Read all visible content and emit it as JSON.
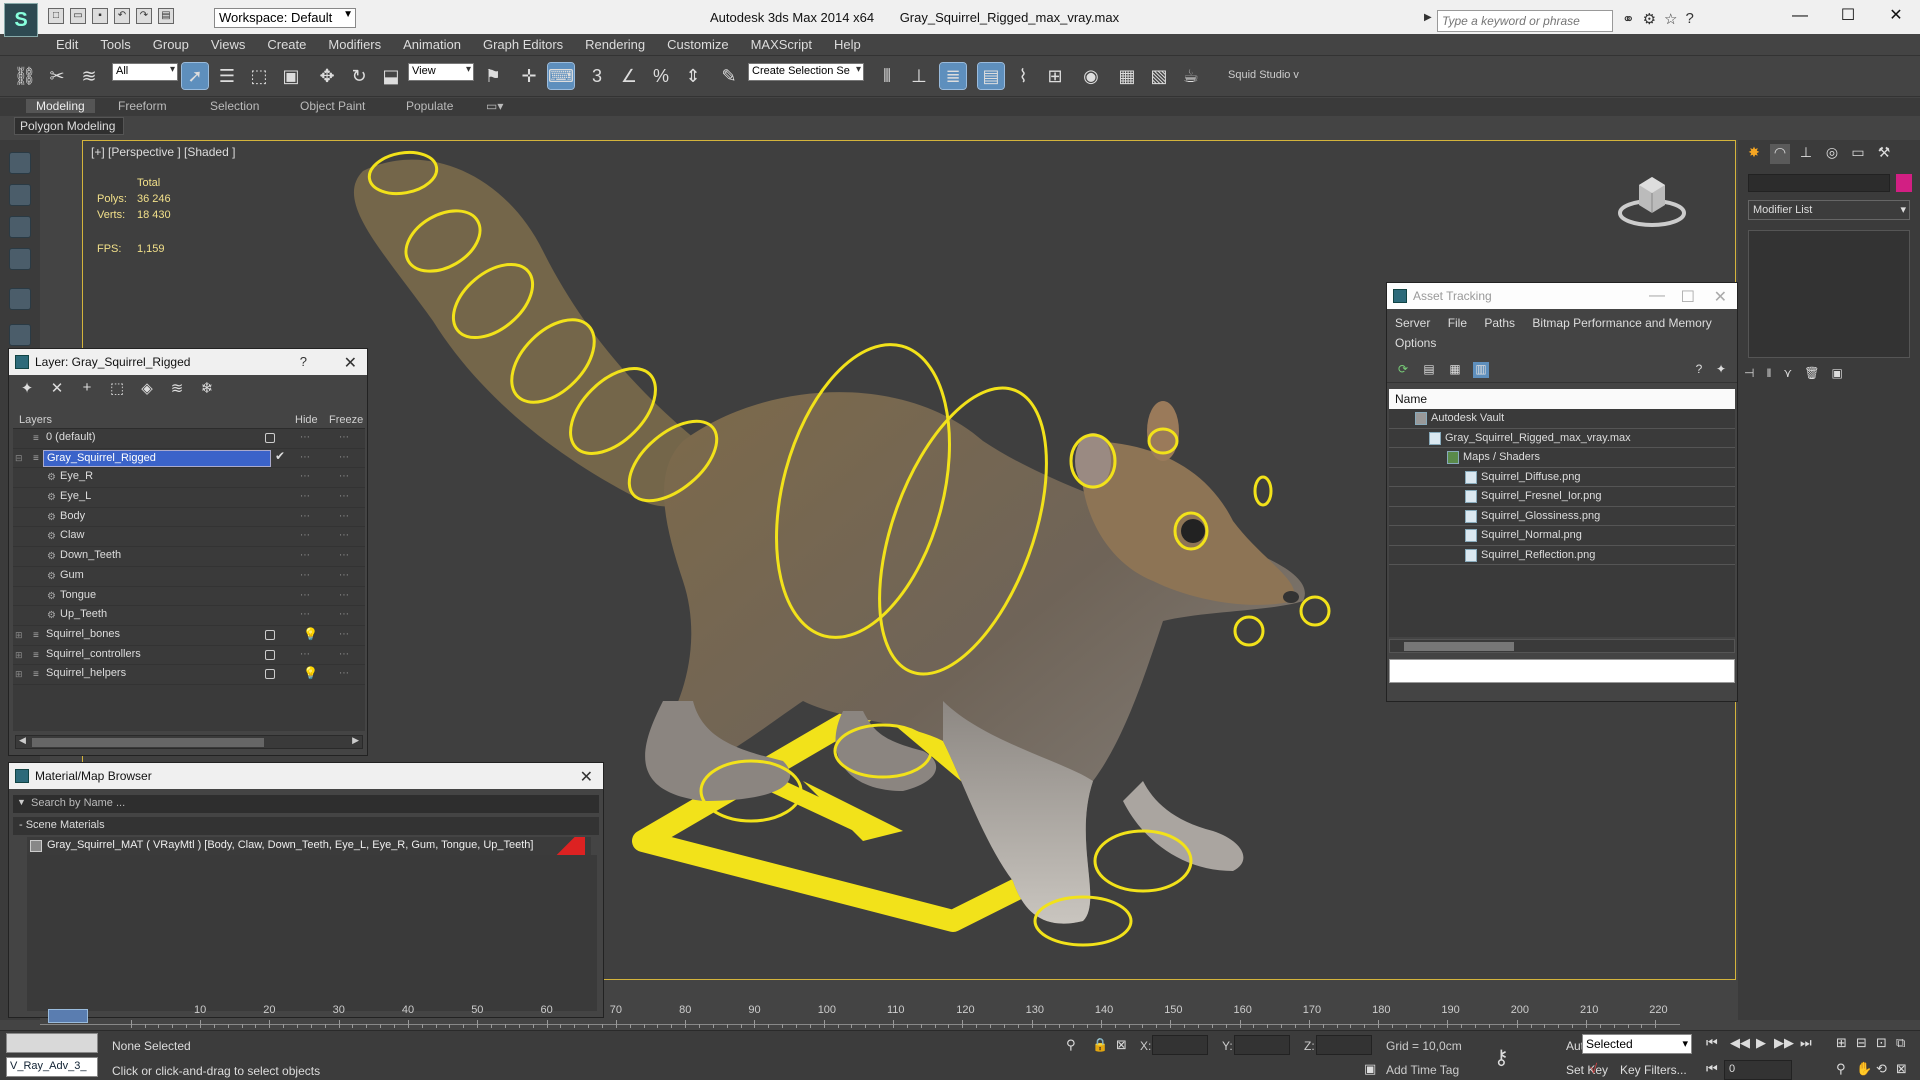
{
  "titlebar": {
    "workspace": "Workspace: Default",
    "app": "Autodesk 3ds Max  2014 x64",
    "file": "Gray_Squirrel_Rigged_max_vray.max",
    "search_placeholder": "Type a keyword or phrase",
    "min": "—",
    "max": "☐",
    "close": "✕"
  },
  "menu": [
    "Edit",
    "Tools",
    "Group",
    "Views",
    "Create",
    "Modifiers",
    "Animation",
    "Graph Editors",
    "Rendering",
    "Customize",
    "MAXScript",
    "Help"
  ],
  "toolbar": {
    "filter": "All",
    "ref_coord": "View",
    "selection_set": "Create Selection Se",
    "squid": "Squid Studio v"
  },
  "ribbon": {
    "tabs": [
      "Modeling",
      "Freeform",
      "Selection",
      "Object Paint",
      "Populate"
    ],
    "sub": "Polygon Modeling"
  },
  "viewport": {
    "label": "[+] [Perspective ] [Shaded ]",
    "stats_header": "Total",
    "polys_label": "Polys:",
    "polys": "36 246",
    "verts_label": "Verts:",
    "verts": "18 430",
    "fps_label": "FPS:",
    "fps": "1,159"
  },
  "layer_window": {
    "title": "Layer: Gray_Squirrel_Rigged",
    "help": "?",
    "col_layers": "Layers",
    "col_hide": "Hide",
    "col_freeze": "Freeze",
    "rows": [
      {
        "name": "0 (default)"
      },
      {
        "name": "Gray_Squirrel_Rigged"
      },
      {
        "name": "Eye_R"
      },
      {
        "name": "Eye_L"
      },
      {
        "name": "Body"
      },
      {
        "name": "Claw"
      },
      {
        "name": "Down_Teeth"
      },
      {
        "name": "Gum"
      },
      {
        "name": "Tongue"
      },
      {
        "name": "Up_Teeth"
      },
      {
        "name": "Squirrel_bones"
      },
      {
        "name": "Squirrel_controllers"
      },
      {
        "name": "Squirrel_helpers"
      }
    ]
  },
  "material_browser": {
    "title": "Material/Map Browser",
    "search": "Search by Name ...",
    "section": "- Scene Materials",
    "material": "Gray_Squirrel_MAT ( VRayMtl ) [Body, Claw, Down_Teeth, Eye_L, Eye_R, Gum, Tongue, Up_Teeth]"
  },
  "asset_tracking": {
    "title": "Asset Tracking",
    "menu": [
      "Server",
      "File",
      "Paths",
      "Bitmap Performance and Memory"
    ],
    "menu_options": "Options",
    "col_name": "Name",
    "rows": [
      {
        "name": "Autodesk Vault"
      },
      {
        "name": "Gray_Squirrel_Rigged_max_vray.max"
      },
      {
        "name": "Maps / Shaders"
      },
      {
        "name": "Squirrel_Diffuse.png"
      },
      {
        "name": "Squirrel_Fresnel_Ior.png"
      },
      {
        "name": "Squirrel_Glossiness.png"
      },
      {
        "name": "Squirrel_Normal.png"
      },
      {
        "name": "Squirrel_Reflection.png"
      }
    ]
  },
  "command_panel": {
    "modifier_list": "Modifier List",
    "colors": {
      "object_color": "#d21f83"
    }
  },
  "timeline": {
    "ticks": [
      "10",
      "20",
      "30",
      "40",
      "50",
      "60",
      "70",
      "80",
      "90",
      "100",
      "110",
      "120",
      "130",
      "140",
      "150",
      "160",
      "170",
      "180",
      "190",
      "200",
      "210",
      "220"
    ]
  },
  "status": {
    "script": "V_Ray_Adv_3_",
    "selected": "None Selected",
    "prompt": "Click or click-and-drag to select objects",
    "x_label": "X:",
    "y_label": "Y:",
    "z_label": "Z:",
    "grid": "Grid = 10,0cm",
    "add_time_tag": "Add Time Tag",
    "auto_key": "Auto Key",
    "set_key": "Set Key",
    "selection": "Selected",
    "key_filters": "Key Filters...",
    "frame": "0"
  },
  "colors": {
    "accent": "#5e8fbd",
    "rig": "#f2e21a",
    "viewport_border": "#d4b43c"
  }
}
